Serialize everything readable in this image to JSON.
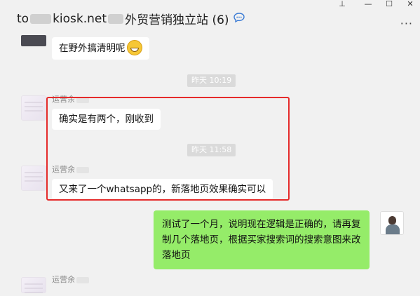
{
  "window": {
    "title_prefix": "to",
    "title_mid": "kiosk.net",
    "title_rest": "外贸营销独立站 (6)",
    "pin_glyph": "⊥",
    "minimize_glyph": "—",
    "maximize_glyph": "☐",
    "close_glyph": "✕",
    "more_glyph": "···"
  },
  "messages": [
    {
      "text": "在野外搞清明呢"
    },
    {
      "time": "昨天 10:19"
    },
    {
      "sender": "运营余",
      "text": "确实是有两个，刚收到"
    },
    {
      "time": "昨天 11:58"
    },
    {
      "sender": "运营余",
      "text": "又来了一个whatsapp的，新落地页效果确实可以"
    },
    {
      "text": "测试了一个月，说明现在逻辑是正确的，请再复制几个落地页，根据买家搜索词的搜索意图来改落地页"
    },
    {
      "sender": "运营余"
    }
  ],
  "colors": {
    "highlight": "#e52b2b",
    "own_bubble": "#95ec69",
    "other_bubble": "#ffffff",
    "background": "#f1f1f1"
  },
  "icons": {
    "title_badge": "chat-bubble-icon",
    "emoji": "grinning-face-icon"
  }
}
